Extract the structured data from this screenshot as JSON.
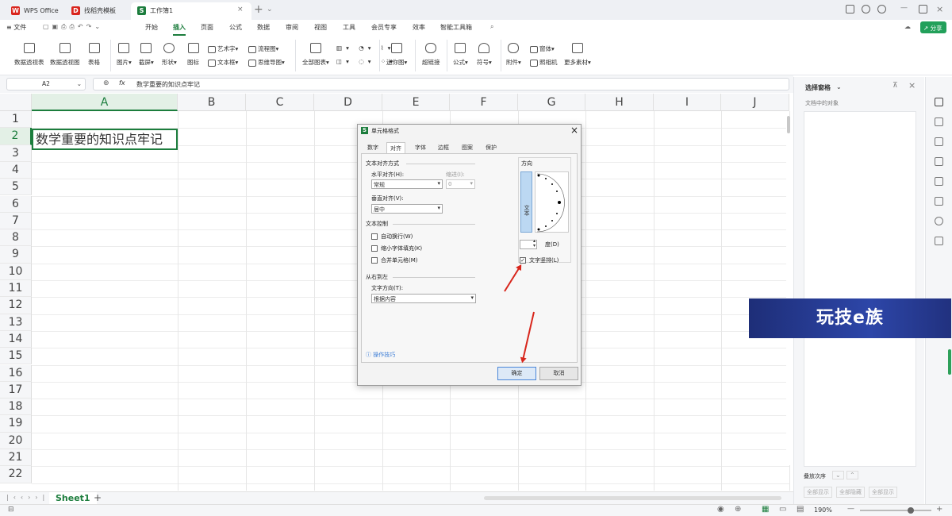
{
  "tabs": [
    {
      "label": "WPS Office",
      "icon": "wps-icon",
      "color": "#d9251d"
    },
    {
      "label": "找稻壳模板",
      "icon": "docer-icon",
      "color": "#d9251d"
    },
    {
      "label": "工作簿1",
      "icon": "sheet-icon",
      "color": "#1c7d3d"
    }
  ],
  "menus": [
    "文件",
    "开始",
    "插入",
    "页面",
    "公式",
    "数据",
    "审阅",
    "视图",
    "工具",
    "会员专享",
    "效率",
    "智能工具箱"
  ],
  "active_menu": "插入",
  "share_label": "分享",
  "ribbon": {
    "large": [
      "数据透视表",
      "数据透视图",
      "表格",
      "图片",
      "截屏",
      "形状",
      "图标",
      "全部图表",
      "迷你图",
      "超链接",
      "公式",
      "符号",
      "附件",
      "更多素材"
    ],
    "small": [
      "艺术字",
      "文本框",
      "流程图",
      "思维导图",
      "窗体",
      "照相机"
    ]
  },
  "formula": {
    "cell_ref": "A2",
    "fx": "fx",
    "content": "数学重要的知识点牢记"
  },
  "columns": [
    "A",
    "B",
    "C",
    "D",
    "E",
    "F",
    "G",
    "H",
    "I",
    "J"
  ],
  "rows": [
    "1",
    "2",
    "3",
    "4",
    "5",
    "6",
    "7",
    "8",
    "9",
    "10",
    "11",
    "12",
    "13",
    "14",
    "15",
    "16",
    "17",
    "18",
    "19",
    "20",
    "21",
    "22"
  ],
  "cell_a2": "数学重要的知识点牢记",
  "sheet_tab": "Sheet1",
  "zoom": "190%",
  "right_panel": {
    "title": "选择窗格",
    "subtitle": "文档中的对象",
    "order_label": "叠放次序",
    "show_all": "全部显示",
    "hide_all": "全部隐藏"
  },
  "banner": "玩技e族",
  "dialog": {
    "title": "单元格格式",
    "tabs": [
      "数字",
      "对齐",
      "字体",
      "边框",
      "图案",
      "保护"
    ],
    "active_tab": "对齐",
    "text_align_section": "文本对齐方式",
    "halign_label": "水平对齐(H):",
    "halign_value": "常规",
    "indent_label": "缩进(I):",
    "indent_value": "0",
    "valign_label": "垂直对齐(V):",
    "valign_value": "居中",
    "text_control_section": "文本控制",
    "wrap_label": "自动换行(W)",
    "shrink_label": "缩小字体填充(K)",
    "merge_label": "合并单元格(M)",
    "rtl_section": "从右到左",
    "direction_label": "文字方向(T):",
    "direction_value": "根据内容",
    "orientation_section": "方向",
    "vertical_text": "文本",
    "degree_label": "度(D)",
    "vertical_chk_label": "文字竖排(L)",
    "vertical_checked": true,
    "tips": "操作技巧",
    "ok": "确定",
    "cancel": "取消"
  }
}
